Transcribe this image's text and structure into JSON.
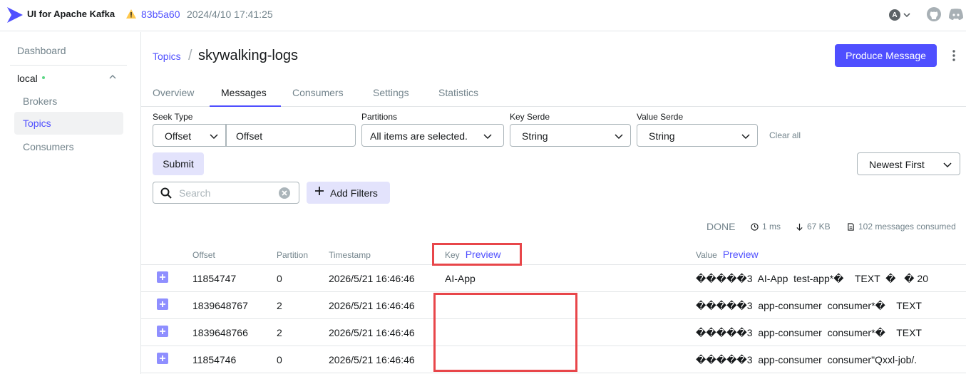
{
  "app": {
    "brand": "UI for Apache Kafka",
    "commit": "83b5a60",
    "commit_date": "2024/4/10 17:41:25",
    "user_initial": "A"
  },
  "sidebar": {
    "dashboard": "Dashboard",
    "cluster": "local",
    "items": [
      {
        "label": "Brokers",
        "active": false
      },
      {
        "label": "Topics",
        "active": true
      },
      {
        "label": "Consumers",
        "active": false
      }
    ]
  },
  "header": {
    "breadcrumb_root": "Topics",
    "separator": "/",
    "title": "skywalking-logs",
    "produce_label": "Produce Message"
  },
  "tabs": [
    {
      "label": "Overview",
      "active": false
    },
    {
      "label": "Messages",
      "active": true
    },
    {
      "label": "Consumers",
      "active": false
    },
    {
      "label": "Settings",
      "active": false
    },
    {
      "label": "Statistics",
      "active": false
    }
  ],
  "filters": {
    "seek_type_label": "Seek Type",
    "seek_type_value": "Offset",
    "offset_placeholder": "Offset",
    "partitions_label": "Partitions",
    "partitions_value": "All items are selected.",
    "key_serde_label": "Key Serde",
    "key_serde_value": "String",
    "value_serde_label": "Value Serde",
    "value_serde_value": "String",
    "clear_all": "Clear all",
    "submit": "Submit",
    "sort_value": "Newest First",
    "search_placeholder": "Search",
    "add_filters": "Add Filters"
  },
  "stats": {
    "status": "DONE",
    "time": "1 ms",
    "size": "67 KB",
    "consumed": "102 messages consumed"
  },
  "table": {
    "columns": {
      "offset": "Offset",
      "partition": "Partition",
      "timestamp": "Timestamp",
      "key": "Key",
      "value": "Value",
      "preview": "Preview"
    },
    "rows": [
      {
        "offset": "11854747",
        "partition": "0",
        "timestamp": "2026/5/21 16:46:46",
        "key": "AI-App",
        "value": "�����3  AI-App  test-app*�    TEXT  �   � 20"
      },
      {
        "offset": "1839648767",
        "partition": "2",
        "timestamp": "2026/5/21 16:46:46",
        "key": "",
        "value": "�����3  app-consumer  consumer*�    TEXT"
      },
      {
        "offset": "1839648766",
        "partition": "2",
        "timestamp": "2026/5/21 16:46:46",
        "key": "",
        "value": "�����3  app-consumer  consumer*�    TEXT"
      },
      {
        "offset": "11854746",
        "partition": "0",
        "timestamp": "2026/5/21 16:46:46",
        "key": "",
        "value": "�����3  app-consumer  consumer\"Qxxl-job/."
      }
    ]
  },
  "colors": {
    "accent": "#4f4fff",
    "annotation": "#e8464a"
  }
}
